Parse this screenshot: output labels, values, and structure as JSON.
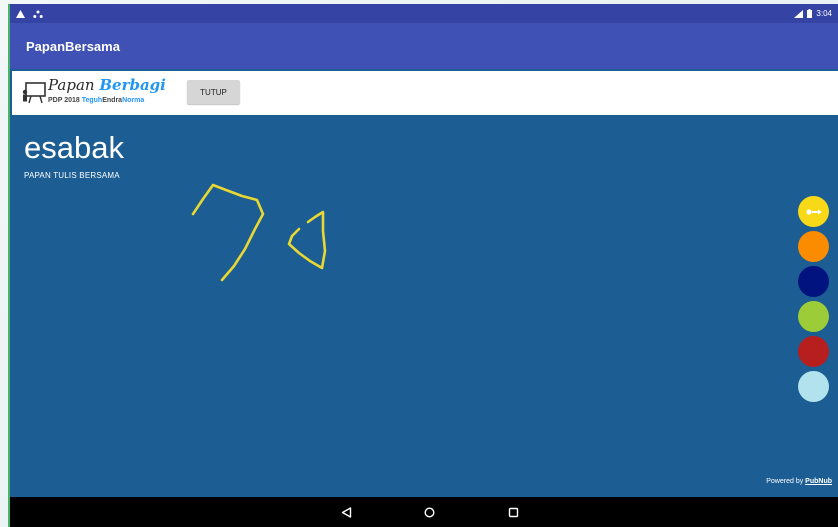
{
  "toolbar": {
    "title": "PapanBersama"
  },
  "banner": {
    "logo_title_main": "Papan ",
    "logo_title_accent": "Berbagi",
    "logo_sub_prefix": "PDP 2018 ",
    "logo_sub_name1": "Teguh",
    "logo_sub_name2": "Endra",
    "logo_sub_name3": "Norma",
    "close_label": "TUTUP"
  },
  "board": {
    "title": "esabak",
    "subtitle": "PAPAN TULIS BERSAMA",
    "stroke_color": "#e9d733"
  },
  "palette": [
    {
      "name": "yellow",
      "color": "#f7d917",
      "selected": true
    },
    {
      "name": "orange",
      "color": "#fb8c00",
      "selected": false
    },
    {
      "name": "navy",
      "color": "#00137f",
      "selected": false
    },
    {
      "name": "green",
      "color": "#9ccc38",
      "selected": false
    },
    {
      "name": "red",
      "color": "#b71f1f",
      "selected": false
    },
    {
      "name": "light-blue",
      "color": "#b2e2ee",
      "selected": false
    }
  ],
  "footer": {
    "powered_prefix": "Powered by ",
    "powered_link": "PubNub"
  },
  "status_bar": {
    "time": "3:04"
  },
  "nav": {
    "back_icon": "back-triangle-icon",
    "home_icon": "home-circle-icon",
    "recents_icon": "recents-square-icon"
  }
}
